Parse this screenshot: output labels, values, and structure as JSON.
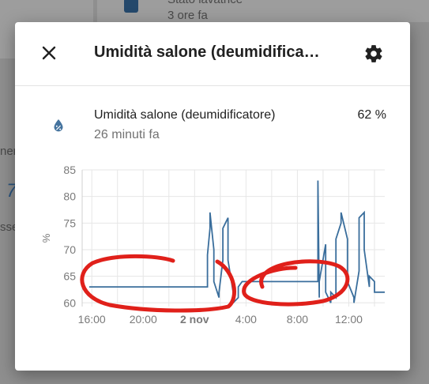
{
  "background": {
    "card_item_title": "Stato lavatrice",
    "card_item_time": "3 ore fa",
    "fragment_1": "ner",
    "fragment_2": "7",
    "fragment_3": "sse"
  },
  "dialog": {
    "title": "Umidità salone (deumidifica…",
    "close_icon": "close-icon",
    "settings_icon": "gear-icon"
  },
  "entity": {
    "icon": "water-percent-icon",
    "name": "Umidità salone (deumidificatore)",
    "last_changed": "26 minuti fa",
    "state": "62 %"
  },
  "colors": {
    "line": "#3a6e9c",
    "annotation": "#e0201a",
    "grid": "#e6e6e6",
    "axis_text": "#7a7a7a"
  },
  "chart_data": {
    "type": "line",
    "title": "",
    "xlabel": "",
    "ylabel": "%",
    "ylim": [
      59.3,
      85
    ],
    "y_ticks": [
      "85",
      "80",
      "75",
      "70",
      "65",
      "60"
    ],
    "x_ticks": [
      "16:00",
      "20:00",
      "2 nov",
      "4:00",
      "8:00",
      "12:00"
    ],
    "grid": true,
    "series": [
      {
        "name": "",
        "x_hours_since_16": [
          -0.2,
          9.0,
          9.0,
          9.2,
          9.2,
          9.5,
          9.5,
          9.9,
          9.9,
          10.2,
          10.2,
          10.6,
          10.6,
          11.0,
          11.0,
          11.4,
          11.4,
          11.7,
          11.7,
          12.1,
          12.1,
          12.3,
          12.3,
          17.6,
          17.6,
          17.7,
          17.7,
          18.2,
          18.2,
          18.6,
          18.6,
          19.0,
          19.0,
          19.4,
          19.4,
          19.9,
          19.9,
          20.4,
          20.4,
          20.8,
          20.8,
          21.2,
          21.2,
          21.6,
          21.6,
          22.0,
          22.0,
          22.4,
          22.4,
          22.8
        ],
        "values": [
          63,
          63,
          69,
          74,
          77,
          70,
          64,
          61,
          62,
          68,
          74,
          76,
          68,
          62,
          60,
          61,
          63,
          64,
          64,
          64,
          64,
          64,
          64,
          64,
          83,
          61,
          64,
          71,
          62,
          60,
          62,
          61,
          72,
          75,
          77,
          72,
          64,
          61,
          60,
          66,
          76,
          77,
          70,
          63,
          65,
          64,
          62,
          62,
          62,
          62
        ]
      }
    ]
  },
  "annotations": {
    "description": ""
  }
}
